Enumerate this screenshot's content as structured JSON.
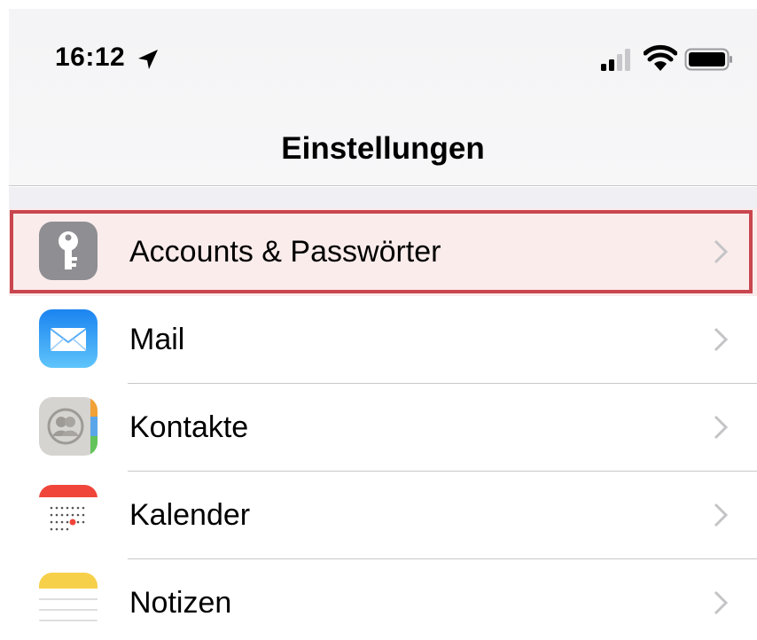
{
  "status_bar": {
    "time": "16:12",
    "icons": [
      "location-arrow-icon",
      "cellular-signal-icon",
      "wifi-icon",
      "battery-icon"
    ]
  },
  "nav": {
    "title": "Einstellungen"
  },
  "settings": {
    "items": [
      {
        "label": "Accounts & Passwörter",
        "icon": "key-icon",
        "highlighted": true
      },
      {
        "label": "Mail",
        "icon": "mail-icon"
      },
      {
        "label": "Kontakte",
        "icon": "contacts-icon"
      },
      {
        "label": "Kalender",
        "icon": "calendar-icon"
      },
      {
        "label": "Notizen",
        "icon": "notes-icon"
      }
    ]
  },
  "colors": {
    "highlight_border": "#c9464e",
    "highlight_fill": "#fbecec",
    "accent_mail": "#1e8ff5",
    "accent_calendar": "#f0453a"
  }
}
